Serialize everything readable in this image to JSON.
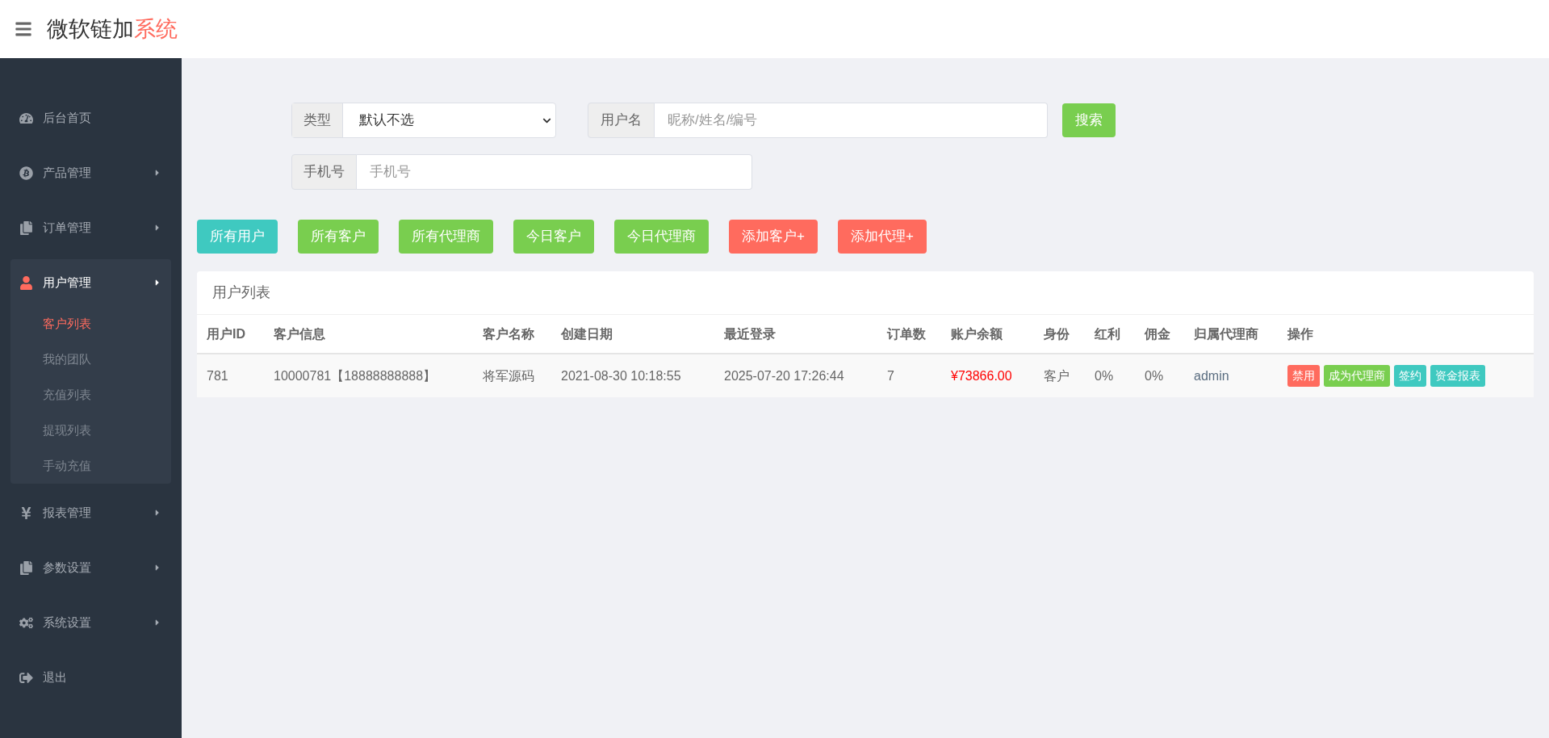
{
  "header": {
    "title_main": "微软链加",
    "title_accent": "系统"
  },
  "sidebar": {
    "items": [
      {
        "label": "后台首页",
        "kind": "link"
      },
      {
        "label": "产品管理",
        "kind": "menu",
        "expanded": false
      },
      {
        "label": "订单管理",
        "kind": "menu",
        "expanded": false
      },
      {
        "label": "用户管理",
        "kind": "menu",
        "expanded": true,
        "children": [
          {
            "label": "客户列表",
            "selected": true
          },
          {
            "label": "我的团队",
            "selected": false
          },
          {
            "label": "充值列表",
            "selected": false
          },
          {
            "label": "提现列表",
            "selected": false
          },
          {
            "label": "手动充值",
            "selected": false
          }
        ]
      },
      {
        "label": "报表管理",
        "kind": "menu",
        "expanded": false
      },
      {
        "label": "参数设置",
        "kind": "menu",
        "expanded": false
      },
      {
        "label": "系统设置",
        "kind": "menu",
        "expanded": false
      },
      {
        "label": "退出",
        "kind": "link"
      }
    ]
  },
  "filters": {
    "type": {
      "label": "类型",
      "value": "默认不选"
    },
    "username": {
      "label": "用户名",
      "placeholder": "昵称/姓名/编号"
    },
    "search_button": "搜索",
    "phone": {
      "label": "手机号",
      "placeholder": "手机号"
    }
  },
  "quick_buttons": [
    {
      "label": "所有用户",
      "color": "#3fc9c0"
    },
    {
      "label": "所有客户",
      "color": "#79ce4f"
    },
    {
      "label": "所有代理商",
      "color": "#79ce4f"
    },
    {
      "label": "今日客户",
      "color": "#79ce4f"
    },
    {
      "label": "今日代理商",
      "color": "#79ce4f"
    },
    {
      "label": "添加客户+",
      "color": "#ff6b5e"
    },
    {
      "label": "添加代理+",
      "color": "#ff6b5e"
    }
  ],
  "table": {
    "title": "用户列表",
    "columns": [
      "用户ID",
      "客户信息",
      "客户名称",
      "创建日期",
      "最近登录",
      "订单数",
      "账户余额",
      "身份",
      "红利",
      "佣金",
      "归属代理商",
      "操作"
    ],
    "rows": [
      {
        "cells": [
          "781",
          "10000781【18888888888】",
          "将军源码",
          "2021-08-30 10:18:55",
          "2025-07-20 17:26:44",
          "7",
          "¥73866.00",
          "客户",
          "0%",
          "0%",
          "admin"
        ],
        "actions": [
          {
            "label": "禁用",
            "color": "#ff6b5e"
          },
          {
            "label": "成为代理商",
            "color": "#79ce4f"
          },
          {
            "label": "签约",
            "color": "#3fc9c0"
          },
          {
            "label": "资金报表",
            "color": "#3fc9c0"
          }
        ]
      }
    ]
  }
}
